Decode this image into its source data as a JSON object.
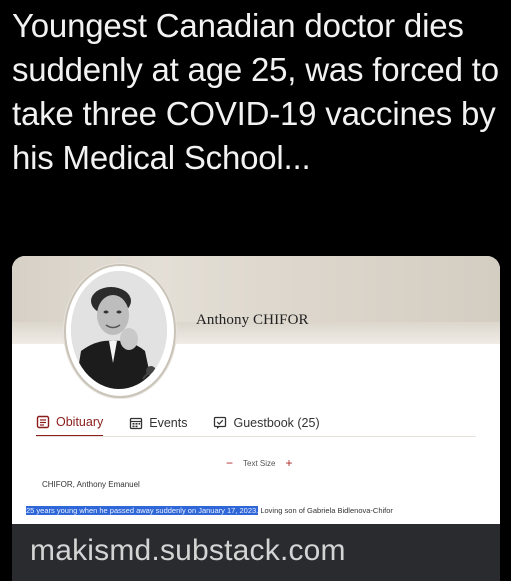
{
  "headline": "Youngest Canadian doctor dies suddenly at age 25, was forced to take three COVID-19 vaccines by his Medical School...",
  "card": {
    "name": "Anthony CHIFOR",
    "tabs": [
      {
        "label": "Obituary",
        "icon": "document-icon",
        "active": true
      },
      {
        "label": "Events",
        "icon": "calendar-icon",
        "active": false
      },
      {
        "label": "Guestbook (25)",
        "icon": "message-icon",
        "active": false
      }
    ],
    "text_size": {
      "label": "Text Size",
      "minus": "−",
      "plus": "+"
    },
    "deceased_name": "CHIFOR, Anthony Emanuel",
    "obituary_highlight": "25 years young when he passed away suddenly on January 17, 2023.",
    "obituary_rest": " Loving son of Gabriela Bidlenova-Chifor"
  },
  "footer": {
    "domain": "makismd.substack.com"
  },
  "colors": {
    "accent": "#8b1d1d",
    "highlight": "#2f67d8",
    "background": "#000000",
    "footer_bg": "#2a2b2f"
  }
}
